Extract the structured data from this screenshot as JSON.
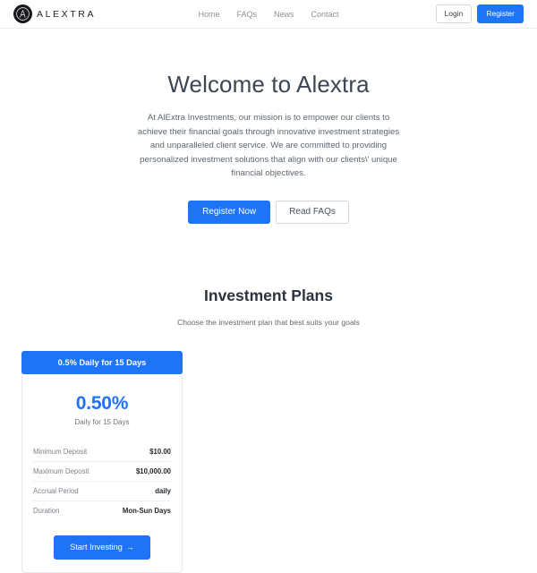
{
  "header": {
    "brand": {
      "mark_icon": "alextra-logo-icon",
      "name": "ALEXTRA"
    },
    "nav": [
      {
        "label": "Home"
      },
      {
        "label": "FAQs"
      },
      {
        "label": "News"
      },
      {
        "label": "Contact"
      }
    ],
    "login_label": "Login",
    "register_label": "Register"
  },
  "hero": {
    "title": "Welcome to Alextra",
    "paragraph": "At AlExtra Investments, our mission is to empower our clients to achieve their financial goals through innovative investment strategies and unparalleled client service. We are committed to providing personalized investment solutions that align with our clients\\' unique financial objectives.",
    "primary_cta": "Register Now",
    "secondary_cta": "Read FAQs"
  },
  "plans": {
    "title": "Investment Plans",
    "subtitle": "Choose the investment plan that best suits your goals",
    "cards": [
      {
        "ribbon": "0.5% Daily for 15 Days",
        "rate": "0.50%",
        "rate_label": "Daily for 15 Days",
        "rows": [
          {
            "label": "Minimum Deposit",
            "value": "$10.00"
          },
          {
            "label": "Maximum Deposit",
            "value": "$10,000.00"
          },
          {
            "label": "Accrual Period",
            "value": "daily"
          },
          {
            "label": "Duration",
            "value": "Mon-Sun Days"
          }
        ],
        "cta": "Start Investing",
        "cta_arrow": "→"
      }
    ]
  },
  "colors": {
    "accent": "#1f74f5",
    "heading": "#3c4753",
    "body_text": "#5d666f",
    "border": "#e9ebee"
  }
}
